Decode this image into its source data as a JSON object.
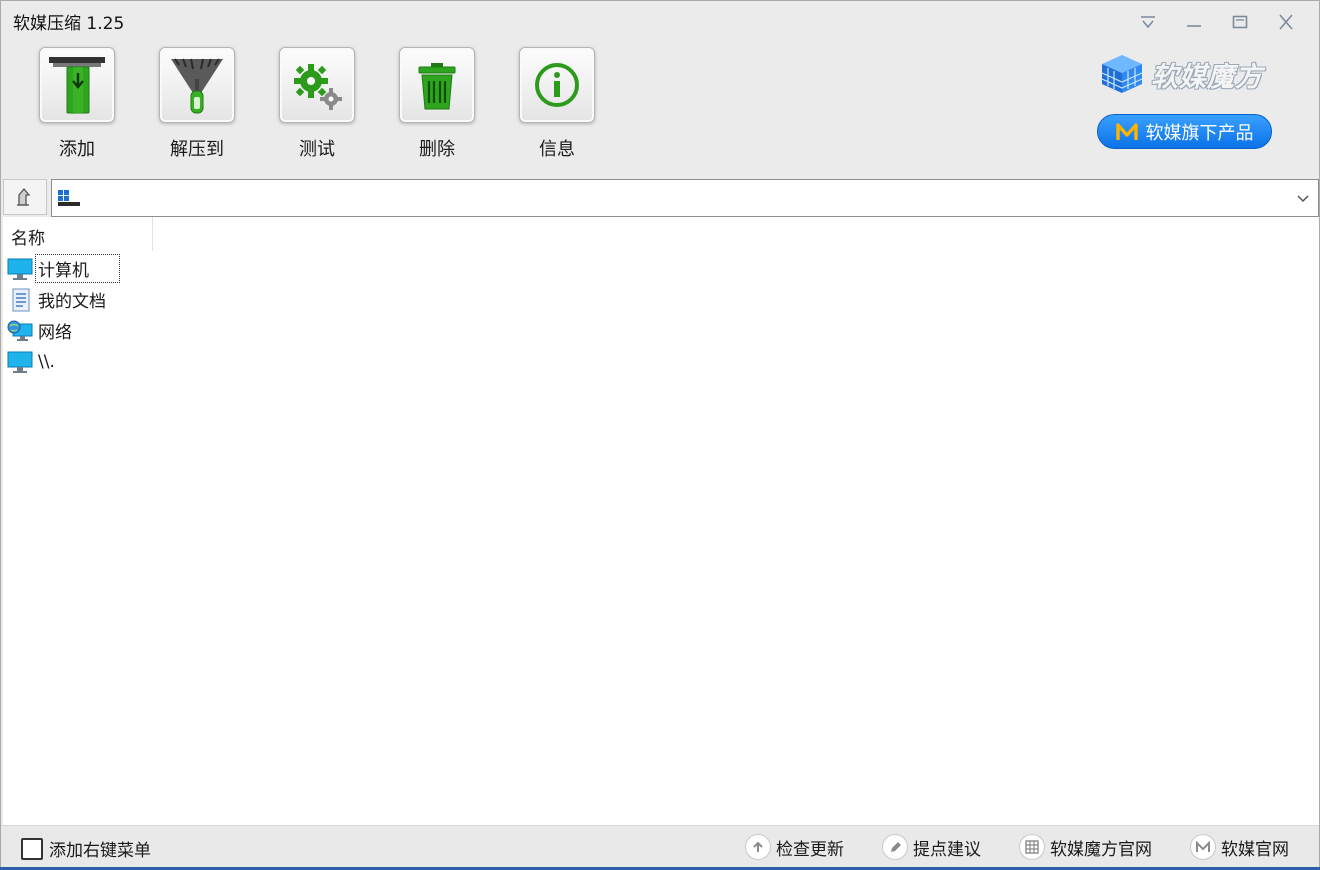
{
  "window": {
    "title": "软媒压缩 1.25",
    "controls": [
      "menu-icon",
      "minimize-icon",
      "maximize-icon",
      "close-icon"
    ]
  },
  "toolbar": {
    "add_label": "添加",
    "extract_label": "解压到",
    "test_label": "测试",
    "delete_label": "删除",
    "info_label": "信息"
  },
  "brand": {
    "name": "软媒魔方",
    "products_button": "软媒旗下产品",
    "accent": "#0b72e8"
  },
  "address": {
    "value": ""
  },
  "list": {
    "column_name": "名称",
    "items": [
      {
        "label": "计算机",
        "icon": "computer-icon"
      },
      {
        "label": "我的文档",
        "icon": "document-icon"
      },
      {
        "label": "网络",
        "icon": "network-icon"
      },
      {
        "label": "\\\\.",
        "icon": "computer-icon"
      }
    ]
  },
  "status": {
    "context_menu_label": "添加右键菜单",
    "check_update": "检查更新",
    "feedback": "提点建议",
    "mofang_site": "软媒魔方官网",
    "ruanmei_site": "软媒官网"
  }
}
